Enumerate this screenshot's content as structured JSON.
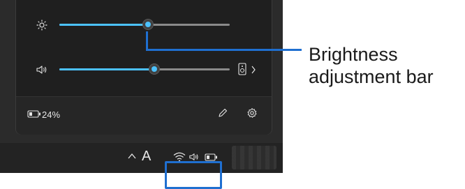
{
  "quick_settings": {
    "brightness": {
      "icon": "brightness-sun-icon",
      "level": 0.55
    },
    "volume": {
      "icon": "speaker-icon",
      "level": 0.57,
      "output_icon": "audio-output-device-icon",
      "expand_icon": "chevron-right-icon"
    },
    "battery": {
      "icon": "battery-icon",
      "percent": "24%"
    },
    "edit_icon": "pencil-icon",
    "settings_icon": "gear-icon"
  },
  "taskbar": {
    "chevron_icon": "chevron-up-icon",
    "input_indicator": "A",
    "tray_icons": [
      "wifi-icon",
      "volume-icon",
      "battery-icon"
    ]
  },
  "callout": {
    "line1": "Brightness",
    "line2": "adjustment bar",
    "color": "#1f6fd0"
  },
  "colors": {
    "accent": "#4cc2ff",
    "panel": "#1f1f1f",
    "taskbar": "#232323"
  }
}
